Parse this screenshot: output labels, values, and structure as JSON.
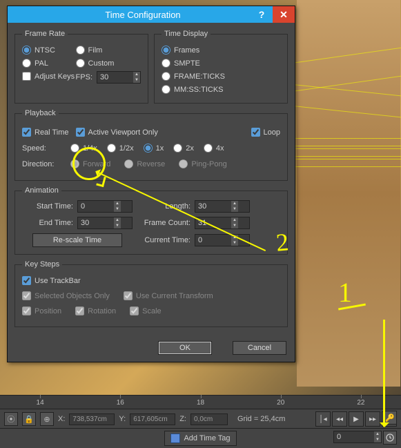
{
  "dialog": {
    "title": "Time Configuration",
    "frame_rate": {
      "legend": "Frame Rate",
      "ntsc": "NTSC",
      "film": "Film",
      "pal": "PAL",
      "custom": "Custom",
      "adjust_keys": "Adjust Keys",
      "fps_label": "FPS:",
      "fps_value": "30"
    },
    "time_display": {
      "legend": "Time Display",
      "frames": "Frames",
      "smpte": "SMPTE",
      "frame_ticks": "FRAME:TICKS",
      "mm_ss_ticks": "MM:SS:TICKS"
    },
    "playback": {
      "legend": "Playback",
      "real_time": "Real Time",
      "active_viewport": "Active Viewport Only",
      "loop": "Loop",
      "speed_label": "Speed:",
      "s_1_4": "1/4x",
      "s_1_2": "1/2x",
      "s_1": "1x",
      "s_2": "2x",
      "s_4": "4x",
      "direction_label": "Direction:",
      "forward": "Forward",
      "reverse": "Reverse",
      "pingpong": "Ping-Pong"
    },
    "animation": {
      "legend": "Animation",
      "start_label": "Start Time:",
      "start_value": "0",
      "end_label": "End Time:",
      "end_value": "30",
      "length_label": "Length:",
      "length_value": "30",
      "count_label": "Frame Count:",
      "count_value": "31",
      "current_label": "Current Time:",
      "current_value": "0",
      "rescale": "Re-scale Time"
    },
    "key_steps": {
      "legend": "Key Steps",
      "use_trackbar": "Use TrackBar",
      "selected_only": "Selected Objects Only",
      "use_transform": "Use Current Transform",
      "position": "Position",
      "rotation": "Rotation",
      "scale": "Scale"
    },
    "ok": "OK",
    "cancel": "Cancel"
  },
  "timeline": {
    "ticks": [
      "14",
      "16",
      "18",
      "20",
      "22"
    ]
  },
  "status": {
    "x_label": "X:",
    "x": "738,537cm",
    "y_label": "Y:",
    "y": "617,605cm",
    "z_label": "Z:",
    "z": "0,0cm",
    "grid": "Grid = 25,4cm"
  },
  "bottom": {
    "add_tag": "Add Time Tag",
    "frame": "0"
  },
  "anno": {
    "n1": "1",
    "n2": "2"
  }
}
